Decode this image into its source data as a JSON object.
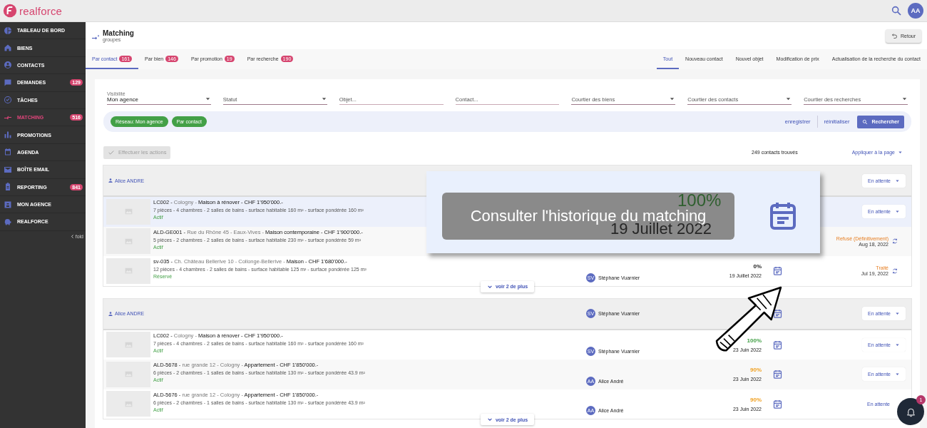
{
  "app": {
    "logo_text": "realforce",
    "avatar": "AA"
  },
  "sidebar": {
    "items": [
      {
        "label": "TABLEAU DE BORD",
        "selected": false
      },
      {
        "label": "BIENS",
        "selected": false
      },
      {
        "label": "CONTACTS",
        "selected": false
      },
      {
        "label": "DEMANDES",
        "badge": "129",
        "selected": false
      },
      {
        "label": "TÂCHES",
        "selected": false
      },
      {
        "label": "MATCHING",
        "badge": "516",
        "selected": true
      },
      {
        "label": "PROMOTIONS",
        "selected": false
      },
      {
        "label": "AGENDA",
        "selected": false
      },
      {
        "label": "BOÎTE EMAIL",
        "selected": false
      },
      {
        "label": "REPORTING",
        "badge": "841",
        "selected": false
      },
      {
        "label": "MON AGENCE",
        "selected": false
      },
      {
        "label": "REALFORCE",
        "selected": false
      }
    ],
    "fold": "fold"
  },
  "header": {
    "title": "Matching",
    "subtitle": "groupes",
    "back_button": "Retour"
  },
  "tabs": [
    {
      "label": "Par contact",
      "count": "161",
      "selected": true
    },
    {
      "label": "Par bien",
      "count": "146",
      "selected": false
    },
    {
      "label": "Par promotion",
      "count": "19",
      "selected": false
    },
    {
      "label": "Par recherche",
      "count": "190",
      "selected": false
    }
  ],
  "type_tabs": [
    {
      "label": "Tout",
      "selected": true
    },
    {
      "label": "Nouveau contact",
      "selected": false
    },
    {
      "label": "Nouvel objet",
      "selected": false
    },
    {
      "label": "Modification de prix",
      "selected": false
    },
    {
      "label": "Actualisation de la recherche du contact",
      "selected": false
    }
  ],
  "filters": [
    {
      "kind": "select",
      "label": "Visibilité",
      "value": "Mon agence"
    },
    {
      "kind": "select",
      "placeholder": "Statut"
    },
    {
      "kind": "input",
      "placeholder": "Objet..."
    },
    {
      "kind": "input",
      "placeholder": "Contact..."
    },
    {
      "kind": "select",
      "placeholder": "Courtier des biens"
    },
    {
      "kind": "select",
      "placeholder": "Courtier des contacts"
    },
    {
      "kind": "select",
      "placeholder": "Courtier des recherches"
    }
  ],
  "chips": [
    "Réseau: Mon agence",
    "Par contact"
  ],
  "save_link": "enregistrer",
  "reset_link": "réinitialiser",
  "search_button": "Rechercher",
  "actions_button": {
    "label": "Effectuer les actions",
    "disabled": true
  },
  "result_count": "249 contacts trouvés",
  "apply_menu": "Appliquer à la page",
  "groups": [
    {
      "contact": "Alice ANDRE",
      "action": {
        "kind": "dropdown",
        "label": "En attente"
      },
      "more_button": "voir 2 de plus",
      "rows": [
        {
          "ref": "LC002 -",
          "location": "Cologny -",
          "summary": "Maison à rénover - CHF 1'950'000.-",
          "details": "7 pièces - 4 chambres - 2 salles de bains - surface habitable 160 m² - surface pondérée 160 m²",
          "status": "Actif",
          "highlighted": true,
          "action": {
            "kind": "dropdown",
            "label": "En attente"
          }
        },
        {
          "ref": "ALD-GE001 -",
          "location": "Rue du Rhône 45 - Eaux-Vives -",
          "summary": "Maison contemporaine - CHF 1'900'000.-",
          "details": "5 pièces - 2 chambres - 2 salles de bains - surface habitable 230 m² - surface pondérée 59 m²",
          "status": "Actif",
          "highlighted": false,
          "action": {
            "kind": "outcome",
            "label": "Refusé (Définitivement)",
            "date": "Aug 18, 2022"
          }
        },
        {
          "ref": "sv-035 -",
          "location": "Ch. Château Bellerive 10 - Collonge-Bellerive -",
          "summary": "Maison - CHF 1'680'000.-",
          "details": "12 pièces - 4 chambres - 2 salles de bains - surface habitable 125 m² - surface pondérée 125 m²",
          "status": "Réservé",
          "highlighted": false,
          "broker": {
            "initials": "SV",
            "name": "Stéphane Vuarnier"
          },
          "match": {
            "score": "0%",
            "date": "19 Juillet 2022",
            "color": "#212121"
          },
          "action": {
            "kind": "outcome",
            "label": "Traité",
            "date": "Jul 19, 2022"
          }
        }
      ]
    },
    {
      "contact": "Alice ANDRE",
      "broker": {
        "initials": "SV",
        "name": "Stéphane Vuarnier"
      },
      "action": {
        "kind": "dropdown",
        "label": "En attente"
      },
      "more_button": "voir 2 de plus",
      "rows": [
        {
          "ref": "LC002 -",
          "location": "Cologny -",
          "summary": "Maison à rénover - CHF 1'950'000.-",
          "details": "7 pièces - 4 chambres - 2 salles de bains - surface habitable 160 m² - surface pondérée 160 m²",
          "status": "Actif",
          "highlighted": false,
          "broker": {
            "initials": "SV",
            "name": "Stéphane Vuarnier"
          },
          "match": {
            "score": "100%",
            "date": "23 Juin 2022",
            "color": "#43a047"
          },
          "action": {
            "kind": "dropdown",
            "label": "En attente"
          }
        },
        {
          "ref": "ALD-5678 -",
          "location": "rue grande 12 - Cologny -",
          "summary": "Appartement - CHF 1'850'000.-",
          "details": "6 pièces - 2 chambres - 1 salles de bains - surface habitable 130 m² - surface pondérée 43.9 m²",
          "status": "Actif",
          "highlighted": false,
          "broker": {
            "initials": "AA",
            "name": "Alice André"
          },
          "match": {
            "score": "90%",
            "date": "23 Juin 2022",
            "color": "#f0a020"
          },
          "action": {
            "kind": "dropdown",
            "label": "En attente"
          }
        },
        {
          "ref": "ALD-5676 -",
          "location": "rue grande 12 - Cologny -",
          "summary": "Appartement - CHF 1'850'000.-",
          "details": "6 pièces - 2 chambres - 1 salles de bains - surface habitable 130 m² - surface pondérée 43.9 m²",
          "status": "Actif",
          "highlighted": false,
          "broker": {
            "initials": "AA",
            "name": "Alice André"
          },
          "match": {
            "score": "90%",
            "date": "23 Juin 2022",
            "color": "#f0a020"
          },
          "action": {
            "kind": "text",
            "label": "En attente"
          }
        }
      ]
    }
  ],
  "callout": {
    "tooltip": "Consulter l'historique du matching",
    "score": "100%",
    "date": "19 Juillet 2022"
  },
  "notifications": {
    "count": "1"
  }
}
